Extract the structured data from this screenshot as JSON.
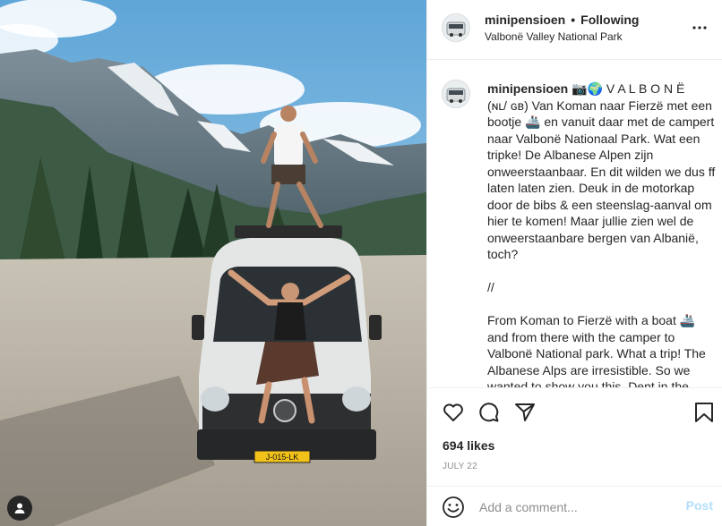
{
  "post": {
    "username": "minipensioen",
    "follow_status": "Following",
    "location": "Valbonë Valley National Park",
    "caption": "📷🌍 V A L B O N Ë\n(ɴʟ/ ɢʙ) Van Koman naar Fierzë met een bootje 🚢 en vanuit daar met de campert naar Valbonë Nationaal Park. Wat een tripke! De Albanese Alpen zijn onweerstaanbaar. En dit wilden we dus ff laten laten zien. Deuk in de motorkap door de bibs & een steenslag-aanval om hier te komen! Maar jullie zien wel de onweerstaanbare bergen van Albanië, toch?\n\n//\n\nFrom Koman to Fierzë with a boat 🚢 and from there with the camper to Valbonë National park. What a trip! The Albanese Alps are irresistible. So we wanted to show you this. Dent in the hood by the",
    "likes": "694 likes",
    "date": "JULY 22",
    "license_plate": "J-015-LK"
  },
  "composer": {
    "placeholder": "Add a comment...",
    "post_label": "Post"
  },
  "icons": {
    "more": "more-options-icon",
    "like": "heart-icon",
    "comment": "comment-icon",
    "share": "paper-plane-icon",
    "save": "bookmark-icon",
    "emoji": "emoji-icon",
    "user": "user-silhouette-icon"
  },
  "colors": {
    "primary_text": "#262626",
    "secondary_text": "#8e8e8e",
    "border": "#efefef",
    "post_disabled": "#b2dffc"
  }
}
